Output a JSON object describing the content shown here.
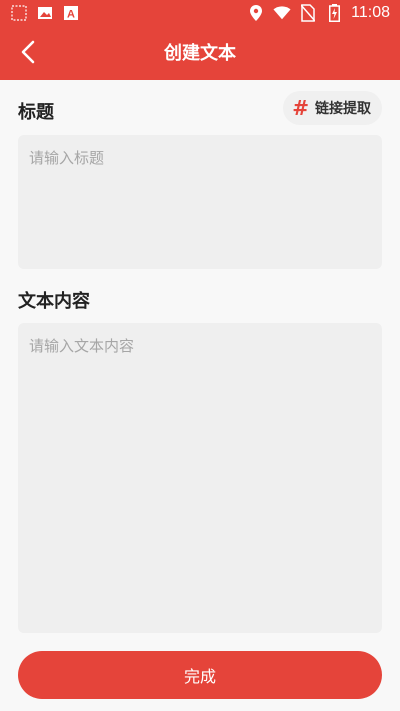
{
  "status_bar": {
    "time": "11:08",
    "left_icons": [
      "notification-icon",
      "image-icon",
      "text-a-icon"
    ],
    "right_icons": [
      "location-icon",
      "wifi-icon",
      "no-sim-icon",
      "battery-charging-icon"
    ]
  },
  "toolbar": {
    "title": "创建文本",
    "back_icon": "chevron-left-icon"
  },
  "form": {
    "title_label": "标题",
    "link_extract_label": "链接提取",
    "title_placeholder": "请输入标题",
    "title_value": "",
    "content_label": "文本内容",
    "content_placeholder": "请输入文本内容",
    "content_value": ""
  },
  "actions": {
    "done_label": "完成"
  },
  "colors": {
    "accent": "#e5443a",
    "input_background": "#efefef",
    "page_background": "#f8f8f8"
  }
}
